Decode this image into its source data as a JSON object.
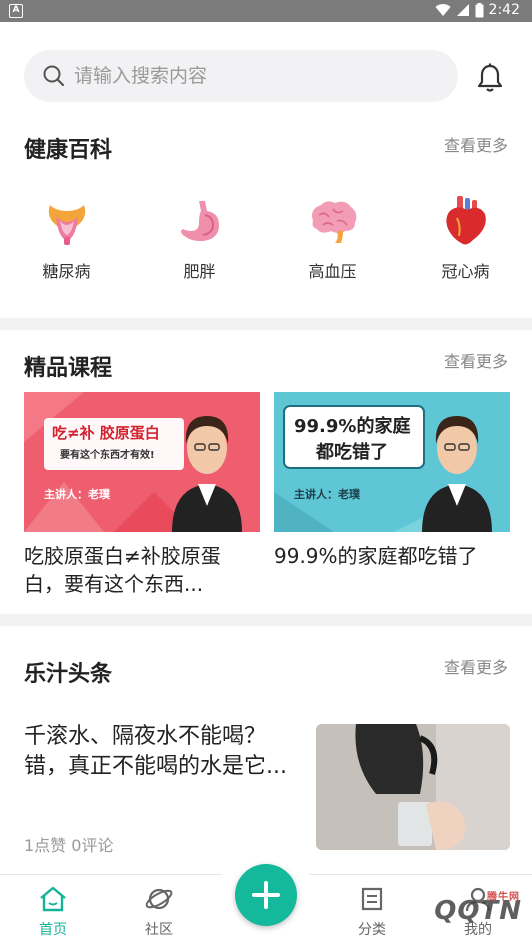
{
  "status_bar": {
    "time": "2:42",
    "app_icon_letter": "A"
  },
  "search": {
    "placeholder": "请输入搜索内容"
  },
  "health": {
    "title": "健康百科",
    "more": "查看更多",
    "categories": [
      {
        "label": "糖尿病",
        "icon": "kidney-icon"
      },
      {
        "label": "肥胖",
        "icon": "stomach-icon"
      },
      {
        "label": "高血压",
        "icon": "brain-icon"
      },
      {
        "label": "冠心病",
        "icon": "heart-icon"
      }
    ]
  },
  "courses": {
    "title": "精品课程",
    "more": "查看更多",
    "items": [
      {
        "title": "吃胶原蛋白≠补胶原蛋白，要有这个东西...",
        "badge_line1": "吃≠补 胶原蛋白",
        "badge_line2": "要有这个东西才有效!",
        "host": "主讲人：老璞",
        "bg": "#ef5e6e"
      },
      {
        "title": "99.9%的家庭都吃错了",
        "badge_line1": "99.9%的家庭",
        "badge_line2": "都吃错了",
        "host": "主讲人：老璞",
        "bg": "#5fc6d6"
      }
    ]
  },
  "news": {
    "title": "乐汁头条",
    "more": "查看更多",
    "article": {
      "headline": "千滚水、隔夜水不能喝？错，真正不能喝的水是它...",
      "meta": "1点赞  0评论"
    }
  },
  "nav": {
    "items": [
      {
        "label": "首页",
        "icon": "home-icon",
        "active": true
      },
      {
        "label": "社区",
        "icon": "planet-icon",
        "active": false
      },
      {
        "label": "分类",
        "icon": "category-icon",
        "active": false
      },
      {
        "label": "我的",
        "icon": "profile-icon",
        "active": false
      }
    ],
    "fab_icon": "plus-icon",
    "accent": "#14b89a"
  },
  "watermark": {
    "text": "QQTN",
    "small": "腾牛网"
  }
}
